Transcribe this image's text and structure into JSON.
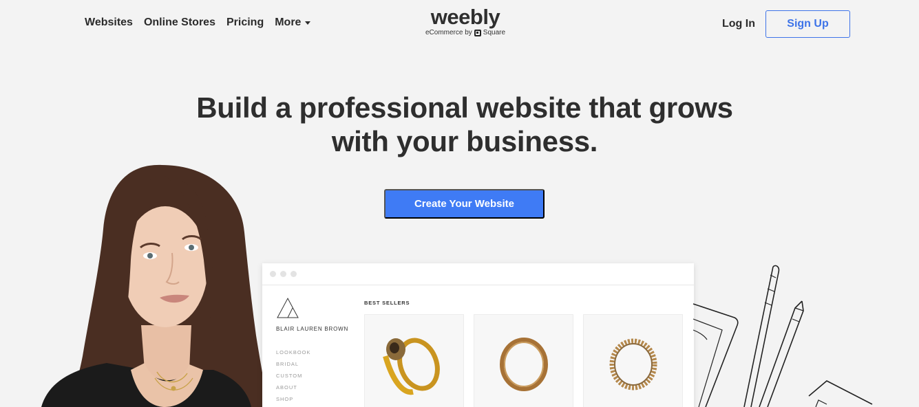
{
  "nav": {
    "links": [
      "Websites",
      "Online Stores",
      "Pricing",
      "More"
    ],
    "login": "Log In",
    "signup": "Sign Up"
  },
  "logo": {
    "word": "weebly",
    "sub_prefix": "eCommerce by",
    "sub_brand": "Square"
  },
  "hero": {
    "headline_line1": "Build a professional website that grows",
    "headline_line2": "with your business.",
    "cta": "Create Your Website"
  },
  "mock": {
    "brand": "BLAIR LAUREN BROWN",
    "menu": [
      "LOOKBOOK",
      "BRIDAL",
      "CUSTOM",
      "ABOUT",
      "SHOP"
    ],
    "section": "BEST SELLERS"
  },
  "colors": {
    "accent": "#3f7bf5",
    "outline": "#3d73e8",
    "background": "#f3f3f3"
  }
}
